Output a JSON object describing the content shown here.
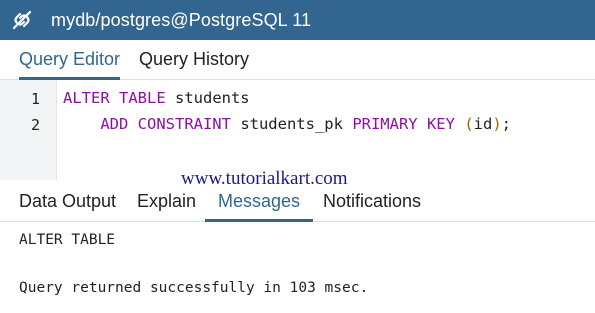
{
  "window": {
    "title": "mydb/postgres@PostgreSQL 11",
    "icon": "connection-link-icon"
  },
  "editor_tabs": [
    {
      "label": "Query Editor",
      "active": true
    },
    {
      "label": "Query History",
      "active": false
    }
  ],
  "editor": {
    "lines": [
      {
        "number": "1",
        "tokens": [
          {
            "text": "ALTER TABLE",
            "kind": "keyword"
          },
          {
            "text": " students",
            "kind": "plain"
          }
        ]
      },
      {
        "number": "2",
        "tokens": [
          {
            "text": "    ADD CONSTRAINT",
            "kind": "keyword"
          },
          {
            "text": " students_pk ",
            "kind": "plain"
          },
          {
            "text": "PRIMARY KEY",
            "kind": "keyword"
          },
          {
            "text": " ",
            "kind": "plain"
          },
          {
            "text": "(",
            "kind": "paren"
          },
          {
            "text": "id",
            "kind": "plain"
          },
          {
            "text": ")",
            "kind": "paren"
          },
          {
            "text": ";",
            "kind": "plain"
          }
        ]
      }
    ]
  },
  "watermark": "www.tutorialkart.com",
  "output_tabs": [
    {
      "label": "Data Output",
      "active": false
    },
    {
      "label": "Explain",
      "active": false
    },
    {
      "label": "Messages",
      "active": true
    },
    {
      "label": "Notifications",
      "active": false
    }
  ],
  "messages": [
    "ALTER TABLE",
    "",
    "Query returned successfully in 103 msec."
  ],
  "colors": {
    "titlebar": "#326690",
    "accent": "#326690",
    "keyword": "#8f0fa6",
    "paren": "#9b6a00"
  }
}
